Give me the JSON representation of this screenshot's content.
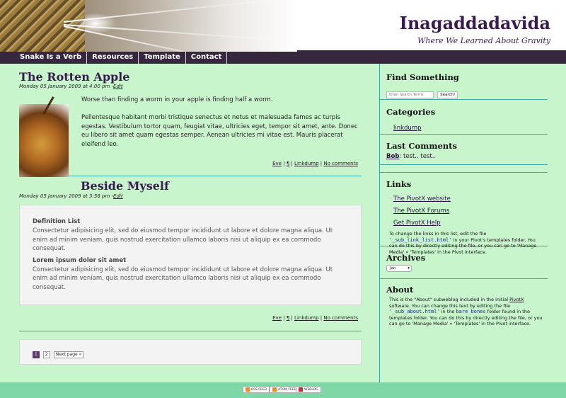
{
  "header": {
    "site_title": "Inagaddadavida",
    "tagline": "Where We Learned About Gravity"
  },
  "nav": {
    "items": [
      "Snake Is a Verb",
      "Resources",
      "Template",
      "Contact"
    ]
  },
  "entries": [
    {
      "title": "The Rotten Apple",
      "meta": "Monday 05 January 2009 at 4:00 pm -",
      "edit_label": "Edit",
      "intro": "Worse than finding a worm in your apple is finding half a worm.",
      "body": "Pellentesque habitant morbi tristique senectus et netus et malesuada fames ac turpis egestas. Vestibulum tortor quam, feugiat vitae, ultricies eget, tempor sit amet, ante. Donec eu libero sit amet quam egestas semper. Aenean ultricies mi vitae est. Mauris placerat eleifend leo.",
      "footer": {
        "author": "Eve",
        "permalink": "¶",
        "category": "Linkdump",
        "comments": "No comments"
      }
    },
    {
      "title": "Beside Myself",
      "meta": "Monday 05 January 2009 at 3:58 pm -",
      "edit_label": "Edit",
      "def_heading_1": "Definition List",
      "def_text_1": "Consectetur adipisicing elit, sed do eiusmod tempor incididunt ut labore et dolore magna aliqua. Ut enim ad minim veniam, quis nostrud exercitation ullamco laboris nisi ut aliquip ex ea commodo consequat.",
      "def_heading_2": "Lorem ipsum dolor sit amet",
      "def_text_2": "Consectetur adipisicing elit, sed do eiusmod tempor incididunt ut labore et dolore magna aliqua. Ut enim ad minim veniam, quis nostrud exercitation ullamco laboris nisi ut aliquip ex ea commodo consequat.",
      "footer": {
        "author": "Eve",
        "permalink": "¶",
        "category": "Linkdump",
        "comments": "No comments"
      }
    }
  ],
  "pagination": {
    "current": "1",
    "page2": "2",
    "next": "Next page »"
  },
  "sidebar": {
    "search": {
      "title": "Find Something",
      "placeholder": "Enter Search Terms",
      "button": "Search!"
    },
    "categories": {
      "title": "Categories",
      "items": [
        "linkdump"
      ]
    },
    "comments": {
      "title": "Last Comments",
      "author": "Bob",
      "text": ": test.. test.."
    },
    "links": {
      "title": "Links",
      "items": [
        "The PivotX website",
        "The PivotX Forums",
        "Get PivotX Help"
      ],
      "note_a": "To change the links in this list, edit the file",
      "note_file": "'_sub_link_list.html'",
      "note_b": " in your Pivot's templates folder. You can do this by directly editing the file, or you can go to 'Manage Media' » 'Templates' in the Pivot interface."
    },
    "archives": {
      "title": "Archives",
      "selected": "Jan"
    },
    "about": {
      "title": "About",
      "text_a": "This is the \"About\" subweblog included in the initial ",
      "link": "PivotX",
      "text_b": " software. You can change this text by editing the file ",
      "file": "'_sub_about.html'",
      "text_c": " in the ",
      "folder": "bare_bones",
      "text_d": " folder found in the templates folder. You can do this by directly editing the file, or you can go to 'Manage Media' » 'Templates' in the Pivot interface."
    }
  },
  "footer": {
    "feeds": [
      "RSS FEED",
      "ATOM FEED",
      "WEBLOG"
    ]
  },
  "colors": {
    "background": "#c8f5cc",
    "header_text": "#3a1a52",
    "nav_bg": "#36273f",
    "rule": "#3aa7a0",
    "footer_bg": "#7fd7a8"
  }
}
